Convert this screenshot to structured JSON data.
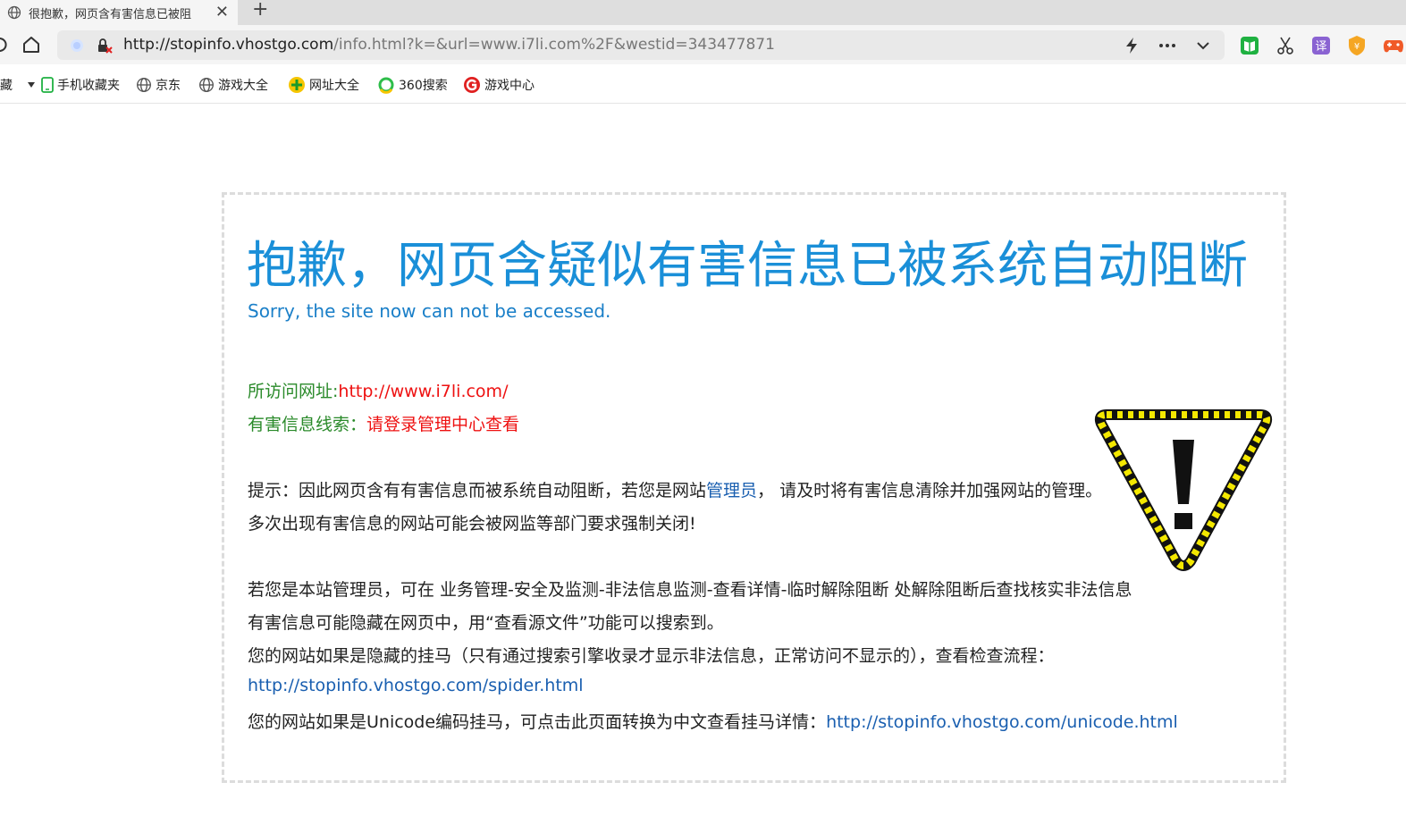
{
  "tab": {
    "title": "很抱歉，网页含有害信息已被阻",
    "close": "✕",
    "new_tab": "+"
  },
  "address": {
    "host": "http://stopinfo.vhostgo.com",
    "path": "/info.html?k=&url=www.i7li.com%2F&westid=343477871"
  },
  "bookmarks": {
    "first": "藏",
    "items": [
      "手机收藏夹",
      "京东",
      "游戏大全",
      "网址大全",
      "360搜索",
      "游戏中心"
    ]
  },
  "notice": {
    "headline": "抱歉，网页含疑似有害信息已被系统自动阻断",
    "subtitle": "Sorry, the site now can not be accessed.",
    "visited_label": "所访问网址:",
    "visited_url": "http://www.i7li.com/",
    "clue_label": "有害信息线索：",
    "clue_value": "请登录管理中心查看",
    "tip_prefix": "提示：因此网页含有有害信息而被系统自动阻断，若您是网站",
    "tip_link": "管理员",
    "tip_suffix": "， 请及时将有害信息清除并加强网站的管理。",
    "tip_line2": "多次出现有害信息的网站可能会被网监等部门要求强制关闭!",
    "admin_line1": "若您是本站管理员，可在 业务管理-安全及监测-非法信息监测-查看详情-临时解除阻断 处解除阻断后查找核实非法信息",
    "admin_line2": "有害信息可能隐藏在网页中，用“查看源文件”功能可以搜索到。",
    "hidden_line": "您的网站如果是隐藏的挂马（只有通过搜索引擎收录才显示非法信息，正常访问不显示的），查看检查流程：",
    "spider_link": "http://stopinfo.vhostgo.com/spider.html",
    "unicode_prefix": "您的网站如果是Unicode编码挂马，可点击此页面转换为中文查看挂马详情：",
    "unicode_link": "http://stopinfo.vhostgo.com/unicode.html"
  },
  "colors": {
    "headline": "#1a8fd8",
    "label_green": "#2a8a2a",
    "alert_red": "#ee1111",
    "link_blue": "#1a5fb0"
  }
}
